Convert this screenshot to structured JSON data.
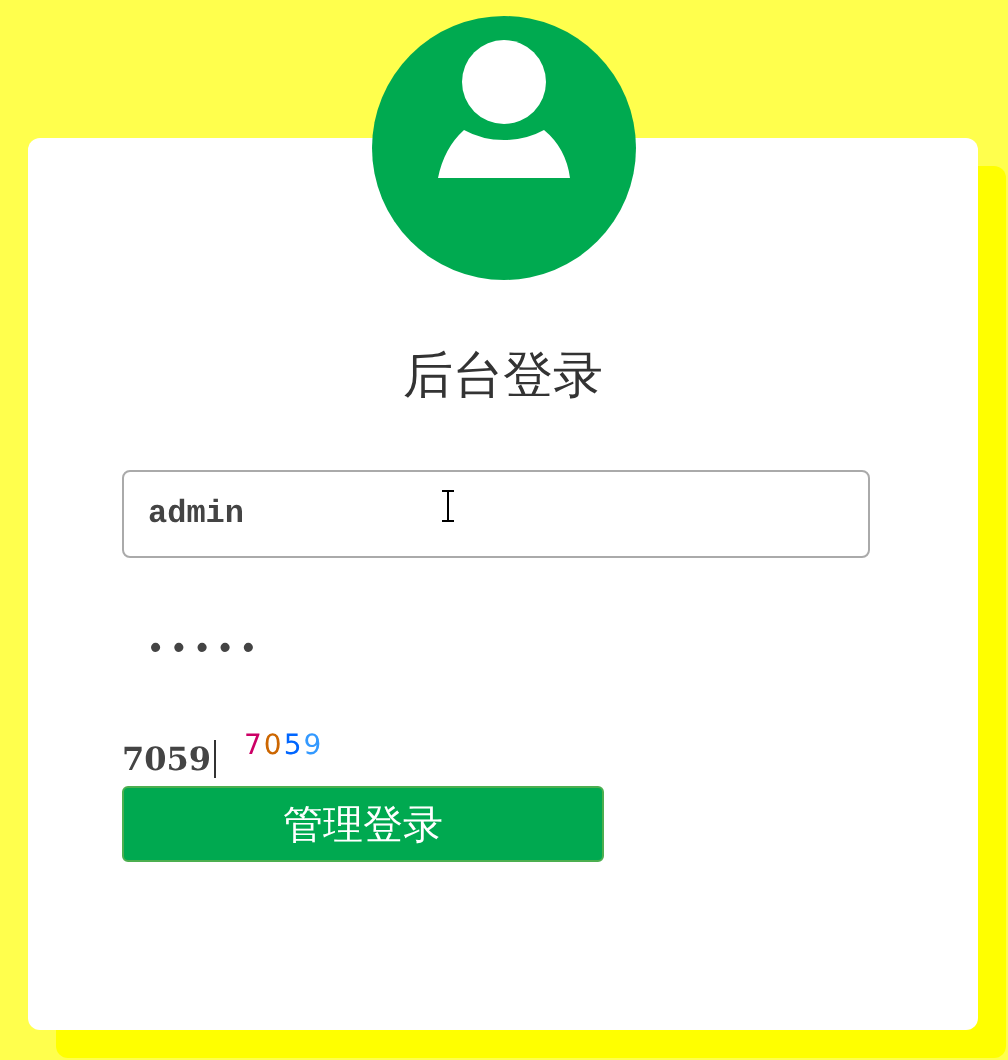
{
  "title": "后台登录",
  "username": {
    "value": "admin"
  },
  "password": {
    "value": "•••••"
  },
  "captcha": {
    "value": "7059",
    "code": [
      {
        "char": "7",
        "color": "#cc0066"
      },
      {
        "char": "0",
        "color": "#cc6600"
      },
      {
        "char": "5",
        "color": "#0066ff"
      },
      {
        "char": "9",
        "color": "#3399ff"
      }
    ]
  },
  "submit": {
    "label": "管理登录"
  }
}
